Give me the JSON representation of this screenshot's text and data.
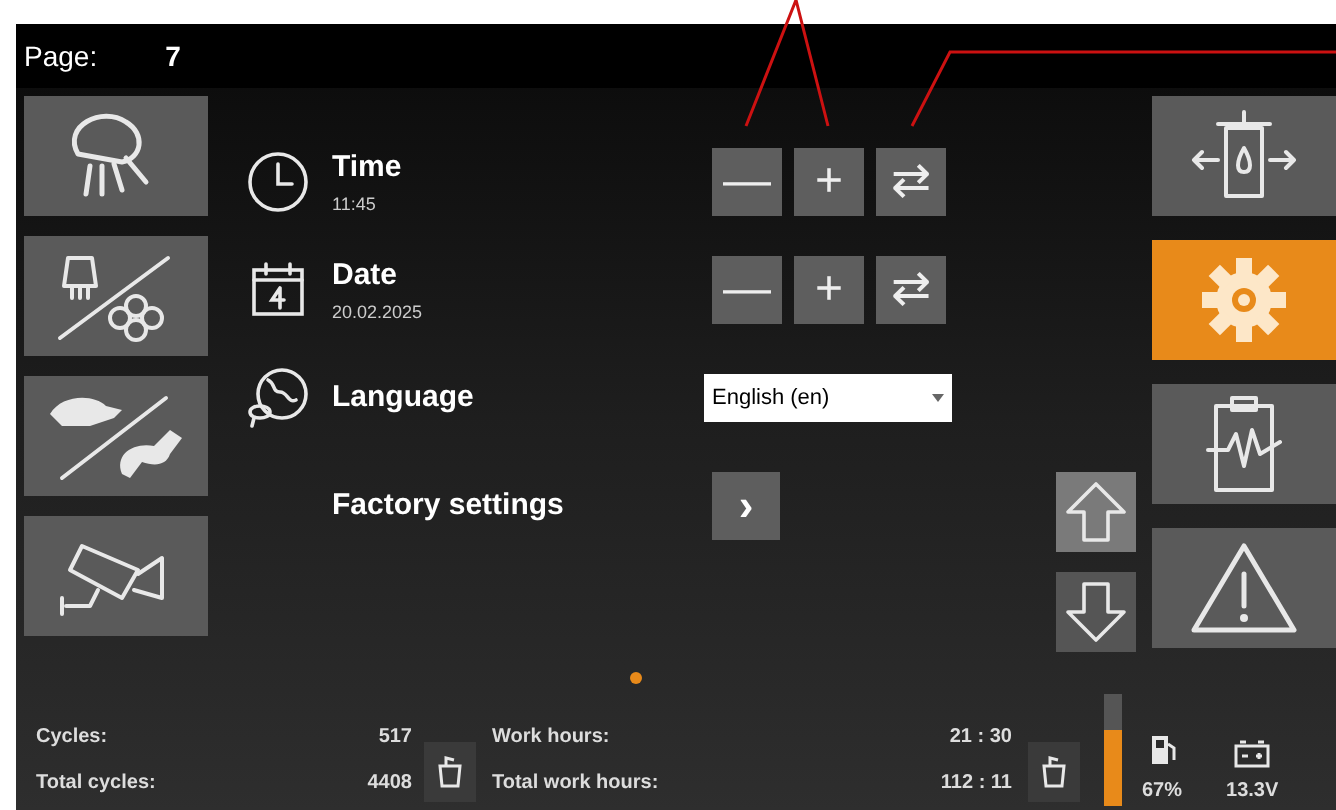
{
  "header": {
    "label": "Page:",
    "page": "7"
  },
  "left_menu": [
    {
      "kind": "shower",
      "selected": false
    },
    {
      "kind": "brush-fan",
      "selected": false
    },
    {
      "kind": "turtle-rabbit",
      "selected": false
    },
    {
      "kind": "camera",
      "selected": false
    }
  ],
  "settings": [
    {
      "kind": "time",
      "title": "Time",
      "value": "11:45",
      "controls": [
        "—",
        "+",
        "⇄"
      ]
    },
    {
      "kind": "date",
      "title": "Date",
      "value": "20.02.2025",
      "controls": [
        "—",
        "+",
        "⇄"
      ]
    },
    {
      "kind": "language",
      "title": "Language",
      "dropdown": "English (en)"
    },
    {
      "kind": "factory",
      "title": "Factory settings",
      "button": "›"
    }
  ],
  "scroll": [
    {
      "kind": "up",
      "active": true
    },
    {
      "kind": "down",
      "active": false
    }
  ],
  "right_menu": [
    {
      "kind": "press",
      "selected": false
    },
    {
      "kind": "gear",
      "selected": true
    },
    {
      "kind": "clipboard",
      "selected": false
    },
    {
      "kind": "warning",
      "selected": false
    }
  ],
  "pager": [
    {
      "selected": true
    }
  ],
  "footer": {
    "cycles_label": "Cycles:",
    "cycles": "517",
    "total_cycles_label": "Total cycles:",
    "total_cycles": "4408",
    "work_hours_label": "Work hours:",
    "work_hours": [
      "21",
      ":",
      "30"
    ],
    "total_work_hours_label": "Total work hours:",
    "total_work_hours": [
      "112",
      ":",
      "11"
    ],
    "tank": {
      "level": 0.67,
      "reading": "67%"
    },
    "battery": "13.3V"
  }
}
